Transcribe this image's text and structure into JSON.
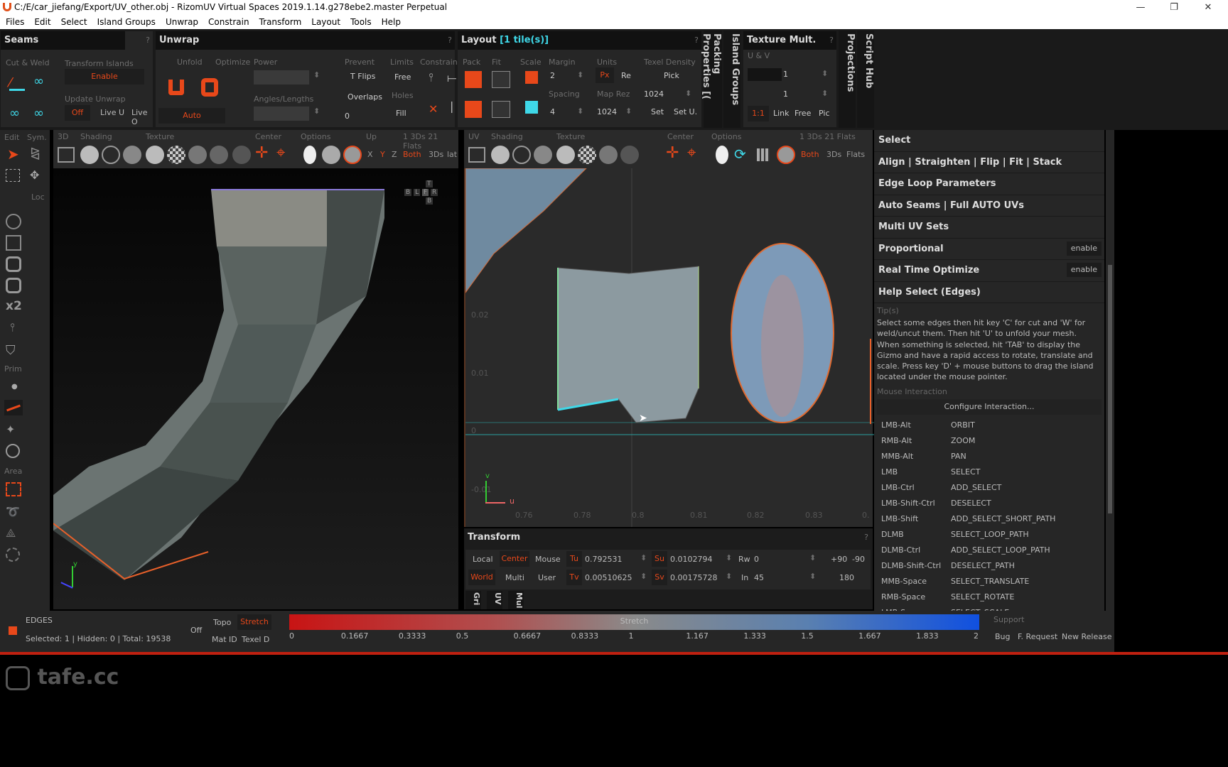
{
  "window": {
    "title": "C:/E/car_jiefang/Export/UV_other.obj - RizomUV  Virtual Spaces 2019.1.14.g278ebe2.master Perpetual",
    "minimize": "—",
    "restore": "❐",
    "close": "✕"
  },
  "menu": [
    "Files",
    "Edit",
    "Select",
    "Island Groups",
    "Unwrap",
    "Constrain",
    "Transform",
    "Layout",
    "Tools",
    "Help"
  ],
  "seams": {
    "title": "Seams",
    "help": "?",
    "cut_weld": "Cut & Weld",
    "transform_islands": "Transform Islands",
    "enable": "Enable",
    "update_unwrap": "Update Unwrap",
    "off": "Off",
    "live_u": "Live U",
    "live_o": "Live O"
  },
  "unwrap": {
    "title": "Unwrap",
    "help": "?",
    "unfold": "Unfold",
    "optimize": "Optimize",
    "power": "Power",
    "angles_lengths": "Angles/Lengths",
    "auto": "Auto",
    "prevent": "Prevent",
    "t_flips": "T Flips",
    "overlaps": "Overlaps",
    "overlaps_value": "0",
    "limits": "Limits",
    "free": "Free",
    "holes": "Holes",
    "fill": "Fill",
    "constraints": "Constraints"
  },
  "layout": {
    "title": "Layout",
    "tiles": "[1 tile(s)]",
    "help": "?",
    "pack": "Pack",
    "fit": "Fit",
    "scale": "Scale",
    "margin": "Margin",
    "margin_value": "2",
    "spacing": "Spacing",
    "spacing_value": "4",
    "units": "Units",
    "px": "Px",
    "re": "Re",
    "map_rez": "Map Rez",
    "map_rez_value": "1024",
    "texel_density": "Texel Density",
    "pick": "Pick",
    "texel_value": "1024",
    "set": "Set",
    "set_u": "Set U."
  },
  "vertical_tabs": {
    "packing": "Packing Properties [(",
    "island_groups": "Island Groups",
    "projections": "Projections",
    "script_hub": "Script Hub"
  },
  "texture_mult": {
    "title": "Texture Mult.",
    "help": "?",
    "uv": "U & V",
    "u_value": "1",
    "v_value": "1",
    "ratio": "1:1",
    "link": "Link",
    "free": "Free",
    "pic": "Pic"
  },
  "left_toolbar": {
    "edit": "Edit",
    "sym": "Sym.",
    "loc": "Loc",
    "x2": "x2",
    "prim": "Prim",
    "area": "Area"
  },
  "view3d": {
    "labels": [
      "3D",
      "Shading",
      "Texture",
      "Center",
      "Options",
      "Up"
    ],
    "stats": "1 3Ds 21 Flats",
    "x": "X",
    "y": "Y",
    "z": "Z",
    "both": "Both",
    "threeds": "3Ds",
    "lat": "lat",
    "cube": [
      "T",
      "B",
      "L",
      "F",
      "R",
      "B"
    ],
    "axis_y": "y"
  },
  "viewuv": {
    "labels": [
      "UV",
      "Shading",
      "Texture",
      "Center",
      "Options"
    ],
    "stats": "1 3Ds 21 Flats",
    "both": "Both",
    "threeds": "3Ds",
    "flats": "Flats",
    "yticks": [
      "0.02",
      "0.01",
      "0",
      "-0.01"
    ],
    "xticks": [
      "0.76",
      "0.78",
      "0.8",
      "0.81",
      "0.82",
      "0.83",
      "0."
    ],
    "axis_u": "u",
    "axis_v": "v"
  },
  "transform": {
    "title": "Transform",
    "help": "?",
    "local": "Local",
    "center": "Center",
    "mouse": "Mouse",
    "world": "World",
    "multi": "Multi",
    "user": "User",
    "tu": "Tu",
    "tu_value": "0.792531",
    "tv": "Tv",
    "tv_value": "0.00510625",
    "su": "Su",
    "su_value": "0.0102794",
    "sv": "Sv",
    "sv_value": "0.00175728",
    "rw": "Rw",
    "rw_value": "0",
    "in": "In",
    "in_value": "45",
    "p90": "+90",
    "m90": "-90",
    "r180": "180"
  },
  "bottom_tabs": [
    "Gri",
    "UV",
    "Mul"
  ],
  "right_panel": {
    "items": [
      "Select",
      "Align | Straighten | Flip | Fit | Stack",
      "Edge Loop Parameters",
      "Auto Seams | Full AUTO UVs",
      "Multi UV Sets",
      "Proportional",
      "Real Time Optimize",
      "Help Select (Edges)"
    ],
    "enable": "enable",
    "tips_label": "Tip(s)",
    "tips": "Select some edges then hit key 'C' for cut and 'W' for weld/uncut them. Then hit 'U' to unfold your mesh. When something is selected, hit 'TAB' to display the Gizmo and have a rapid access to rotate, translate and scale. Press key 'D' + mouse buttons to drag the island located under the mouse pointer.",
    "mouse_interaction": "Mouse Interaction",
    "configure": "Configure Interaction...",
    "bindings": [
      [
        "LMB-Alt",
        "ORBIT"
      ],
      [
        "RMB-Alt",
        "ZOOM"
      ],
      [
        "MMB-Alt",
        "PAN"
      ],
      [
        "LMB",
        "SELECT"
      ],
      [
        "LMB-Ctrl",
        "ADD_SELECT"
      ],
      [
        "LMB-Shift-Ctrl",
        "DESELECT"
      ],
      [
        "LMB-Shift",
        "ADD_SELECT_SHORT_PATH"
      ],
      [
        "DLMB",
        "SELECT_LOOP_PATH"
      ],
      [
        "DLMB-Ctrl",
        "ADD_SELECT_LOOP_PATH"
      ],
      [
        "DLMB-Shift-Ctrl",
        "DESELECT_PATH"
      ],
      [
        "MMB-Space",
        "SELECT_TRANSLATE"
      ],
      [
        "RMB-Space",
        "SELECT_ROTATE"
      ],
      [
        "LMB-Space",
        "SELECT_SCALE"
      ]
    ]
  },
  "status": {
    "mode": "EDGES",
    "selection": "Selected: 1 | Hidden: 0 | Total: 19538",
    "off": "Off",
    "topo": "Topo",
    "stretch": "Stretch",
    "mat_id": "Mat ID",
    "texel_d": "Texel D",
    "bar_label": "Stretch",
    "ticks": [
      "0",
      "0.1667",
      "0.3333",
      "0.5",
      "0.6667",
      "0.8333",
      "1",
      "1.167",
      "1.333",
      "1.5",
      "1.667",
      "1.833",
      "2"
    ],
    "support": "Support",
    "bug": "Bug",
    "request": "F. Request",
    "release": "New Release"
  },
  "watermark": "tafe.cc",
  "colors": {
    "accent": "#e8481a",
    "highlight": "#3fd8e8",
    "panel": "#262626"
  }
}
